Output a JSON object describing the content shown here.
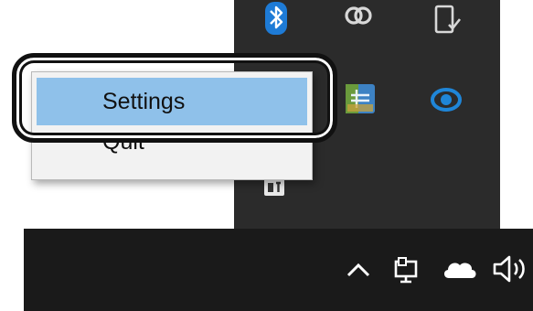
{
  "context_menu": {
    "items": [
      {
        "label": "Settings",
        "state": "highlighted"
      },
      {
        "label": "Quit",
        "state": "normal"
      }
    ]
  },
  "tray_flyout": {
    "icons": [
      "bluetooth-icon",
      "sync-icon",
      "phone-link-icon",
      "network-app-icon",
      "blue-eye-app-icon",
      "small-app-icon"
    ]
  },
  "taskbar": {
    "icons": [
      "show-hidden-icons-chevron-icon",
      "network-icon",
      "onedrive-cloud-icon",
      "volume-icon"
    ]
  },
  "colors": {
    "flyout_bg": "#2b2b2b",
    "taskbar_bg": "#1a1a1a",
    "menu_highlight": "#8fc1ea",
    "bluetooth_blue": "#1e7bd6"
  }
}
